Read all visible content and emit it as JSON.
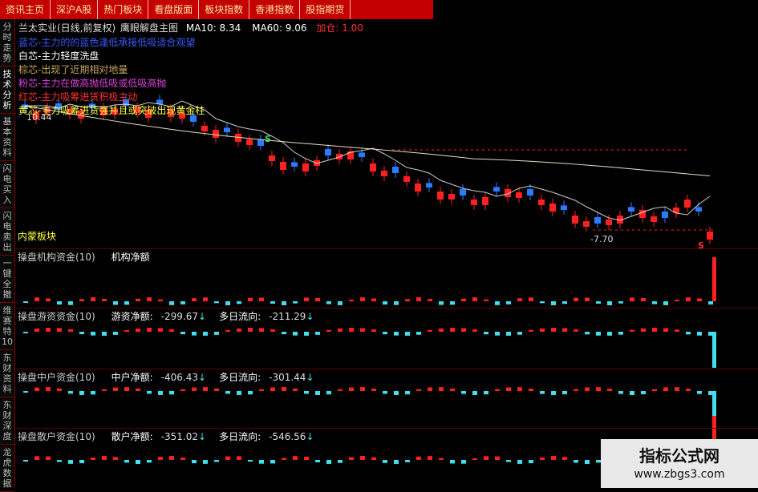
{
  "topbar": [
    "资讯主页",
    "深沪A股",
    "热门板块",
    "看盘版面",
    "板块指数",
    "香港指数",
    "股指期货"
  ],
  "sidebar": [
    "分时走势",
    "技术分析",
    "基本资料",
    "闪电买入",
    "闪电卖出",
    "一键全撤",
    "维赛特10",
    "东财资料",
    "东财深度",
    "龙虎数据"
  ],
  "header": {
    "stock": "兰太实业(日线,前复权)",
    "indicator": "鹰眼解盘主图",
    "ma10": "MA10: 8.34",
    "ma60": "MA60: 9.06",
    "extra": "加仓: 1.00"
  },
  "legends": [
    {
      "text": "蓝芯-主力的的蓝色逢低承接低吸适合观望",
      "color": "#3a5bff"
    },
    {
      "text": "白芯-主力轻度洗盘",
      "color": "#ffffff"
    },
    {
      "text": "棕芯-出现了近期相对地量",
      "color": "#c9a55a"
    },
    {
      "text": "粉芯-主力在做高抛低吸或低吸高抛",
      "color": "#e040e0"
    },
    {
      "text": "红芯-主力吸筹进货积极主动",
      "color": "#ff3030"
    },
    {
      "text": "黄芯-主力吸筹进货强并且或突破出现黄金柱",
      "color": "#ffff40"
    }
  ],
  "labels": {
    "high": "10.44",
    "low": "-7.70",
    "sector": "内蒙板块",
    "s_mark": "S"
  },
  "panels": [
    {
      "name": "操盘机构资金(10)",
      "label": "机构净额",
      "value": "",
      "flow_label": "",
      "flow": ""
    },
    {
      "name": "操盘游资资金(10)",
      "label": "游资净额:",
      "value": "-299.67",
      "flow_label": "多日流向:",
      "flow": "-211.29"
    },
    {
      "name": "操盘中户资金(10)",
      "label": "中户净额:",
      "value": "-406.43",
      "flow_label": "多日流向:",
      "flow": "-301.44"
    },
    {
      "name": "操盘散户资金(10)",
      "label": "散户净额:",
      "value": "-351.02",
      "flow_label": "多日流向:",
      "flow": "-546.56"
    }
  ],
  "arrow": "↓",
  "watermark": {
    "line1": "指标公式网",
    "line2": "www.zbgs3.com"
  },
  "colors": {
    "up": "#ff2020",
    "down": "#2a7bff",
    "cyan": "#40e0f0",
    "ma": "#e8e0c0"
  }
}
